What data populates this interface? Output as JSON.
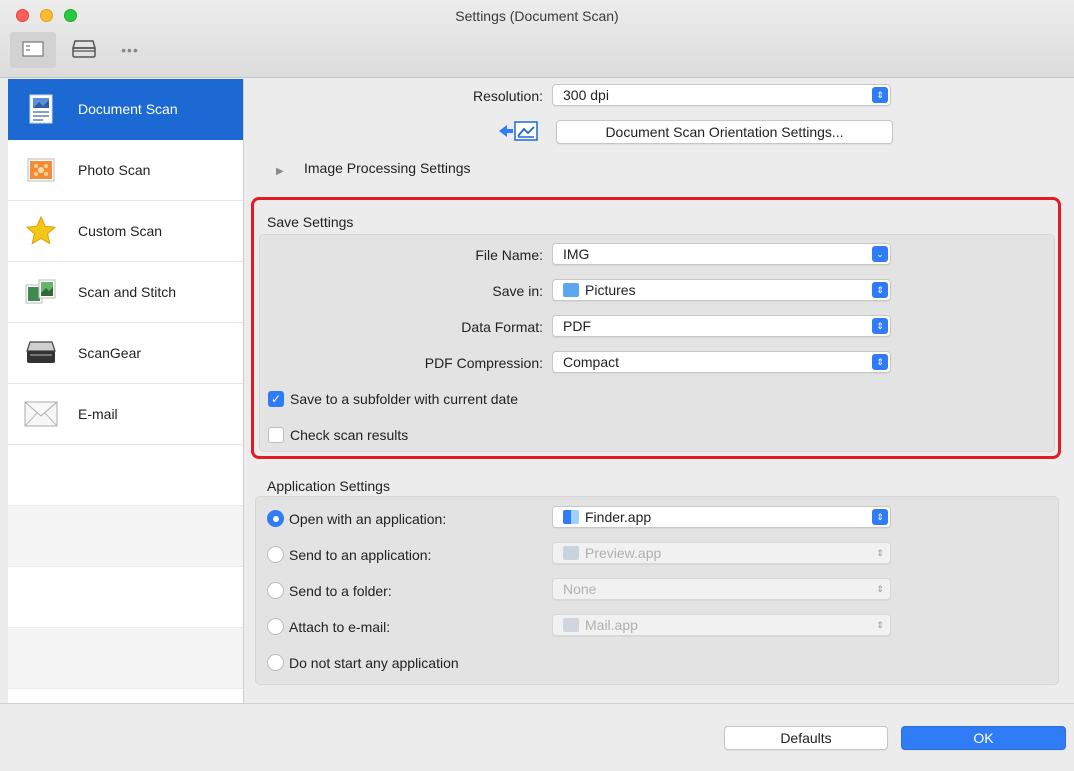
{
  "window": {
    "title": "Settings (Document Scan)"
  },
  "toolbar": {
    "buttons": [
      {
        "name": "document-settings-icon"
      },
      {
        "name": "scanner-icon"
      },
      {
        "name": "more-icon",
        "glyph": "•••"
      }
    ]
  },
  "sidebar": {
    "items": [
      {
        "label": "Document Scan",
        "icon": "document-scan-icon",
        "active": true
      },
      {
        "label": "Photo Scan",
        "icon": "photo-scan-icon",
        "active": false
      },
      {
        "label": "Custom Scan",
        "icon": "star-icon",
        "active": false
      },
      {
        "label": "Scan and Stitch",
        "icon": "scan-stitch-icon",
        "active": false
      },
      {
        "label": "ScanGear",
        "icon": "scanner-icon",
        "active": false
      },
      {
        "label": "E-mail",
        "icon": "envelope-icon",
        "active": false
      }
    ]
  },
  "scan": {
    "resolution_label": "Resolution:",
    "resolution_value": "300 dpi",
    "orientation_button": "Document Scan Orientation Settings...",
    "image_processing_label": "Image Processing Settings"
  },
  "save_settings": {
    "title": "Save Settings",
    "file_name_label": "File Name:",
    "file_name_value": "IMG",
    "save_in_label": "Save in:",
    "save_in_value": "Pictures",
    "data_format_label": "Data Format:",
    "data_format_value": "PDF",
    "pdf_compression_label": "PDF Compression:",
    "pdf_compression_value": "Compact",
    "subfolder_label": "Save to a subfolder with current date",
    "subfolder_checked": true,
    "check_results_label": "Check scan results",
    "check_results_checked": false
  },
  "app_settings": {
    "title": "Application Settings",
    "options": [
      {
        "label": "Open with an application:",
        "selected": true,
        "value": "Finder.app",
        "enabled": true
      },
      {
        "label": "Send to an application:",
        "selected": false,
        "value": "Preview.app",
        "enabled": false
      },
      {
        "label": "Send to a folder:",
        "selected": false,
        "value": "None",
        "enabled": false
      },
      {
        "label": "Attach to e-mail:",
        "selected": false,
        "value": "Mail.app",
        "enabled": false
      },
      {
        "label": "Do not start any application",
        "selected": false
      }
    ]
  },
  "footer": {
    "defaults_label": "Defaults",
    "ok_label": "OK"
  },
  "colors": {
    "accent": "#2f7cf6",
    "sidebar_active": "#1c69d4",
    "highlight": "#e01b24"
  }
}
